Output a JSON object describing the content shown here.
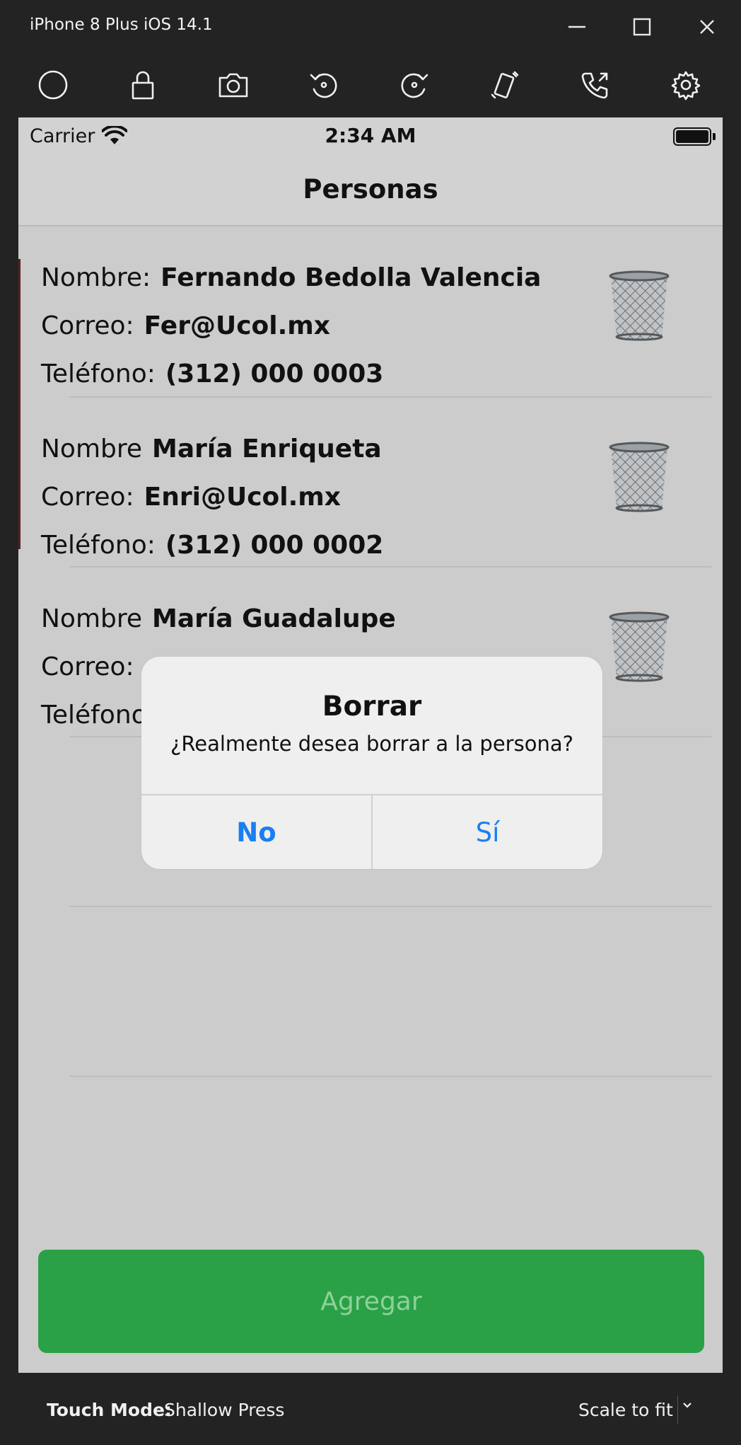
{
  "window": {
    "title": "iPhone 8 Plus iOS 14.1",
    "controls": [
      "minimize",
      "maximize",
      "close"
    ]
  },
  "toolbar": {
    "tools": [
      "home-icon",
      "lock-icon",
      "screenshot-icon",
      "rotate-left-icon",
      "rotate-right-icon",
      "shake-icon",
      "call-icon",
      "settings-icon"
    ]
  },
  "statusbar": {
    "carrier": "Carrier",
    "time": "2:34 AM"
  },
  "navbar": {
    "title": "Personas"
  },
  "people": [
    {
      "name_label": "Nombre:",
      "name": "Fernando Bedolla Valencia",
      "email_label": "Correo:",
      "email": "Fer@Ucol.mx",
      "phone_label": "Teléfono:",
      "phone": "(312) 000 0003"
    },
    {
      "name_label": "Nombre",
      "name": "María Enriqueta",
      "email_label": "Correo:",
      "email": "Enri@Ucol.mx",
      "phone_label": "Teléfono:",
      "phone": "(312) 000 0002"
    },
    {
      "name_label": "Nombre",
      "name": "María Guadalupe",
      "email_label": "Correo:",
      "phone_label": "Teléfono:"
    }
  ],
  "add_button": {
    "label": "Agregar"
  },
  "alert": {
    "title": "Borrar",
    "message": "¿Realmente desea borrar a la persona?",
    "no_label": "No",
    "yes_label": "Sí"
  },
  "bottombar": {
    "touch_mode_label": "Touch Mode:",
    "touch_mode_value": "Shallow Press",
    "scale_label": "Scale to fit"
  },
  "colors": {
    "accent_blue": "#1a7ff0",
    "add_button_green": "#2aa146",
    "screen_bg": "#cccccc",
    "chrome_bg": "#232323"
  }
}
